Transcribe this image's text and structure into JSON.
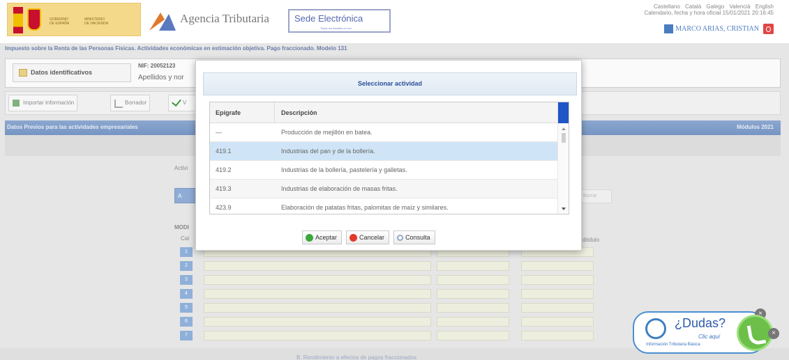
{
  "header": {
    "agency_name": "Agencia Tributaria",
    "sede_title": "Sede Electrónica",
    "sede_subtitle": "Todos los trámites en red",
    "lang_links": [
      "Castellano",
      "Català",
      "Galego",
      "Valencià",
      "English"
    ],
    "date_line": "Calendario, fecha y hora oficial 15/01/2021 20:16:45",
    "user_name": "MARCO ARIAS, CRISTIAN"
  },
  "breadcrumb": "Impuesto sobre la Renta de las Personas Físicas. Actividades económicas en estimación objetiva. Pago fraccionado. Modelo 131",
  "id_section": {
    "button_label": "Datos identificativos",
    "nif_label": "NIF: 20052123",
    "name_label": "Apellidos y nor"
  },
  "toolbar": {
    "import_label": "Importar información",
    "draft_label": "Borrador",
    "validate_label": "V"
  },
  "bluebar": {
    "left": "Datos Previos para las actividades empresariales",
    "right": "Módulos 2021"
  },
  "background": {
    "activity_label": "Activi",
    "bgbtn_label": "A",
    "modules_label": "MODI",
    "col_label": "Cal",
    "col2_label": "dódulo",
    "ghost_label": "Borrar",
    "row_numbers": [
      "1",
      "2",
      "3",
      "4",
      "5",
      "6",
      "7"
    ],
    "footer_text": "B. Rendimiento a efectos de pagos fraccionados"
  },
  "modal": {
    "title": "Seleccionar actividad",
    "columns": [
      "Epígrafe",
      "Descripción"
    ],
    "rows": [
      {
        "code": "—",
        "desc": "Producción de mejillón en batea."
      },
      {
        "code": "419.1",
        "desc": "Industrias del pan y de la bollería."
      },
      {
        "code": "419.2",
        "desc": "Industrias de la bollería, pastelería y galletas."
      },
      {
        "code": "419.3",
        "desc": "Industrias de elaboración de masas fritas."
      },
      {
        "code": "423.9",
        "desc": "Elaboración de patatas fritas, palomitas de maíz y similares."
      }
    ],
    "buttons": {
      "accept": "Aceptar",
      "cancel": "Cancelar",
      "query": "Consulta"
    }
  },
  "help": {
    "question": "¿Dudas?",
    "click": "Clic aquí",
    "info": "Información Tributaria Básica"
  }
}
